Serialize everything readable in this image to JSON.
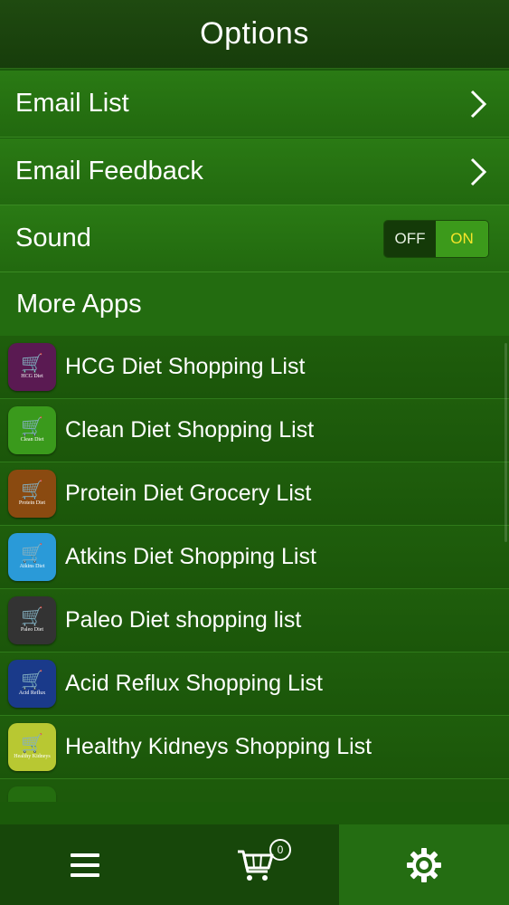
{
  "header": {
    "title": "Options"
  },
  "menu": {
    "email_list": "Email List",
    "email_feedback": "Email Feedback",
    "sound": "Sound",
    "sound_toggle": {
      "off": "OFF",
      "on": "ON",
      "state": "on"
    }
  },
  "more_apps": {
    "heading": "More Apps",
    "items": [
      {
        "name": "HCG Diet Shopping List",
        "icon_text": "HCG Diet",
        "color": "#5a1a52"
      },
      {
        "name": "Clean Diet Shopping List",
        "icon_text": "Clean Diet",
        "color": "#3a9a1c"
      },
      {
        "name": "Protein Diet Grocery List",
        "icon_text": "Protein Diet",
        "color": "#8a4a10"
      },
      {
        "name": "Atkins Diet Shopping List",
        "icon_text": "Atkins Diet",
        "color": "#2a9ad8"
      },
      {
        "name": "Paleo Diet shopping list",
        "icon_text": "Paleo Diet",
        "color": "#333333"
      },
      {
        "name": "Acid Reflux Shopping List",
        "icon_text": "Acid Reflux",
        "color": "#1a3a8a"
      },
      {
        "name": "Healthy Kidneys Shopping List",
        "icon_text": "Healthy Kidneys",
        "color": "#b8c832"
      }
    ]
  },
  "tabbar": {
    "cart_count": "0"
  }
}
